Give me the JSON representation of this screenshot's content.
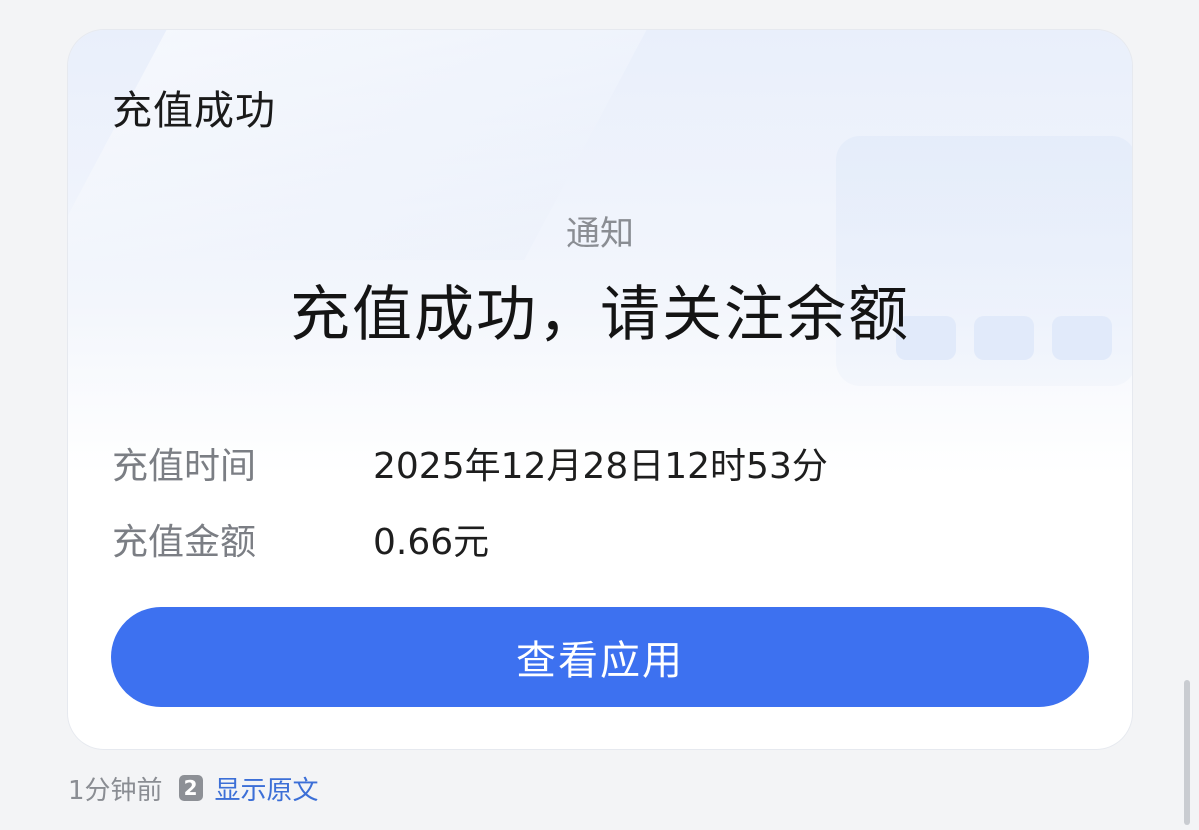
{
  "card": {
    "title": "充值成功",
    "notice_label": "通知",
    "headline": "充值成功，请关注余额",
    "rows": [
      {
        "key": "充值时间",
        "value": "2025年12月28日12时53分"
      },
      {
        "key": "充值金额",
        "value": "0.66元"
      }
    ],
    "button_label": "查看应用"
  },
  "meta": {
    "time_ago": "1分钟前",
    "badge": "2",
    "show_original_link": "显示原文"
  },
  "colors": {
    "accent": "#3d71f0",
    "link": "#3c6fd7",
    "page_background": "#f3f4f6"
  }
}
